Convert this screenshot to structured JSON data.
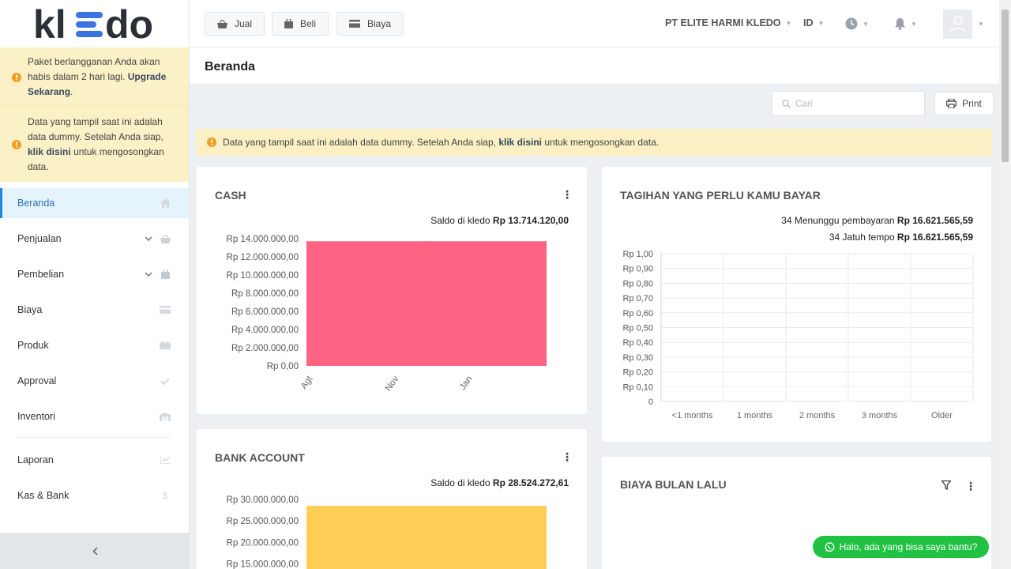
{
  "brand": {
    "logo_text": "kledo"
  },
  "sidebar": {
    "alerts": [
      {
        "pre": "Paket berlangganan Anda akan habis dalam 2 hari lagi. ",
        "link": "Upgrade Sekarang",
        "post": "."
      },
      {
        "pre": "Data yang tampil saat ini adalah data dummy. Setelah Anda siap, ",
        "link": "klik disini",
        "post": " untuk mengosongkan data."
      }
    ],
    "items": [
      {
        "label": "Beranda",
        "icon": "home-icon"
      },
      {
        "label": "Penjualan",
        "icon": "basket-icon"
      },
      {
        "label": "Pembelian",
        "icon": "bag-icon"
      },
      {
        "label": "Biaya",
        "icon": "card-icon"
      },
      {
        "label": "Produk",
        "icon": "box-icon"
      },
      {
        "label": "Approval",
        "icon": "check-icon"
      },
      {
        "label": "Inventori",
        "icon": "warehouse-icon"
      },
      {
        "label": "Laporan",
        "icon": "chart-icon"
      },
      {
        "label": "Kas & Bank",
        "icon": "dollar-icon"
      }
    ],
    "collapse_label": "‹"
  },
  "topbar": {
    "jual": "Jual",
    "beli": "Beli",
    "biaya": "Biaya",
    "company": "PT ELITE HARMI KLEDO",
    "language": "ID"
  },
  "page": {
    "title": "Beranda"
  },
  "search": {
    "placeholder": "Cari"
  },
  "print_label": "Print",
  "banner": {
    "pre": "Data yang tampil saat ini adalah data dummy. Setelah Anda siap, ",
    "link": "klik disini",
    "post": " untuk mengosongkan data."
  },
  "cash": {
    "title": "CASH",
    "saldo_label": "Saldo di kledo",
    "saldo_value": "Rp 13.714.120,00"
  },
  "bank": {
    "title": "BANK ACCOUNT",
    "saldo_label": "Saldo di kledo",
    "saldo_value": "Rp 28.524.272,61"
  },
  "tagihan": {
    "title": "TAGIHAN YANG PERLU KAMU BAYAR",
    "line1_label": "34 Menunggu pembayaran",
    "line1_value": "Rp 16.621.565,59",
    "line2_label": "34 Jatuh tempo",
    "line2_value": "Rp 16.621.565,59"
  },
  "biaya_lalu": {
    "title": "BIAYA BULAN LALU"
  },
  "whatsapp": {
    "label": "Halo, ada yang bisa saya bantu?"
  },
  "colors": {
    "cash_bar": "#fe6383",
    "bank_bar": "#fecd56",
    "accent": "#1e88e5",
    "whatsapp": "#21c143",
    "alert_bg": "#fbf1c7"
  },
  "chart_data": [
    {
      "type": "area",
      "title": "CASH",
      "categories": [
        "Agt",
        "Nov",
        "Jan"
      ],
      "values": [
        13714120,
        13714120,
        13714120
      ],
      "y_ticks": [
        "Rp 14.000.000,00",
        "Rp 12.000.000,00",
        "Rp 10.000.000,00",
        "Rp 8.000.000,00",
        "Rp 6.000.000,00",
        "Rp 4.000.000,00",
        "Rp 2.000.000,00",
        "Rp 0,00"
      ],
      "ylim": [
        0,
        14000000
      ],
      "color": "#fe6383"
    },
    {
      "type": "bar",
      "title": "TAGIHAN YANG PERLU KAMU BAYAR",
      "categories": [
        "<1 months",
        "1 months",
        "2 months",
        "3 months",
        "Older"
      ],
      "values": [
        0,
        0,
        0,
        0,
        0
      ],
      "y_ticks": [
        "Rp 1,00",
        "Rp 0,90",
        "Rp 0,80",
        "Rp 0,70",
        "Rp 0,60",
        "Rp 0,50",
        "Rp 0,40",
        "Rp 0,30",
        "Rp 0,20",
        "Rp 0,10",
        "0"
      ],
      "ylim": [
        0,
        1
      ],
      "grid": true
    },
    {
      "type": "area",
      "title": "BANK ACCOUNT",
      "values": [
        28524272.61
      ],
      "y_ticks": [
        "Rp 30.000.000,00",
        "Rp 25.000.000,00",
        "Rp 20.000.000,00",
        "Rp 15.000.000,00"
      ],
      "ylim": [
        0,
        30000000
      ],
      "color": "#fecd56"
    }
  ]
}
